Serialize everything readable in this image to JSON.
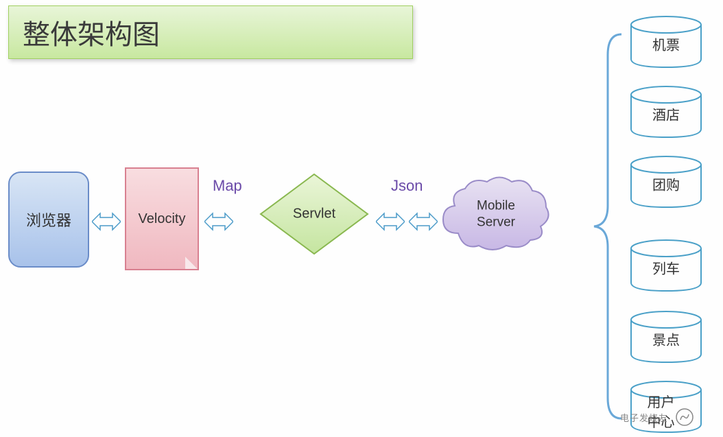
{
  "title": "整体架构图",
  "nodes": {
    "browser": "浏览器",
    "velocity": "Velocity",
    "servlet": "Servlet",
    "mobileServer": "Mobile Server"
  },
  "labels": {
    "map": "Map",
    "json": "Json"
  },
  "services": {
    "s1": "机票",
    "s2": "酒店",
    "s3": "团购",
    "s4": "列车",
    "s5": "景点",
    "s6": "用户中心"
  },
  "watermark": "电子发烧友"
}
